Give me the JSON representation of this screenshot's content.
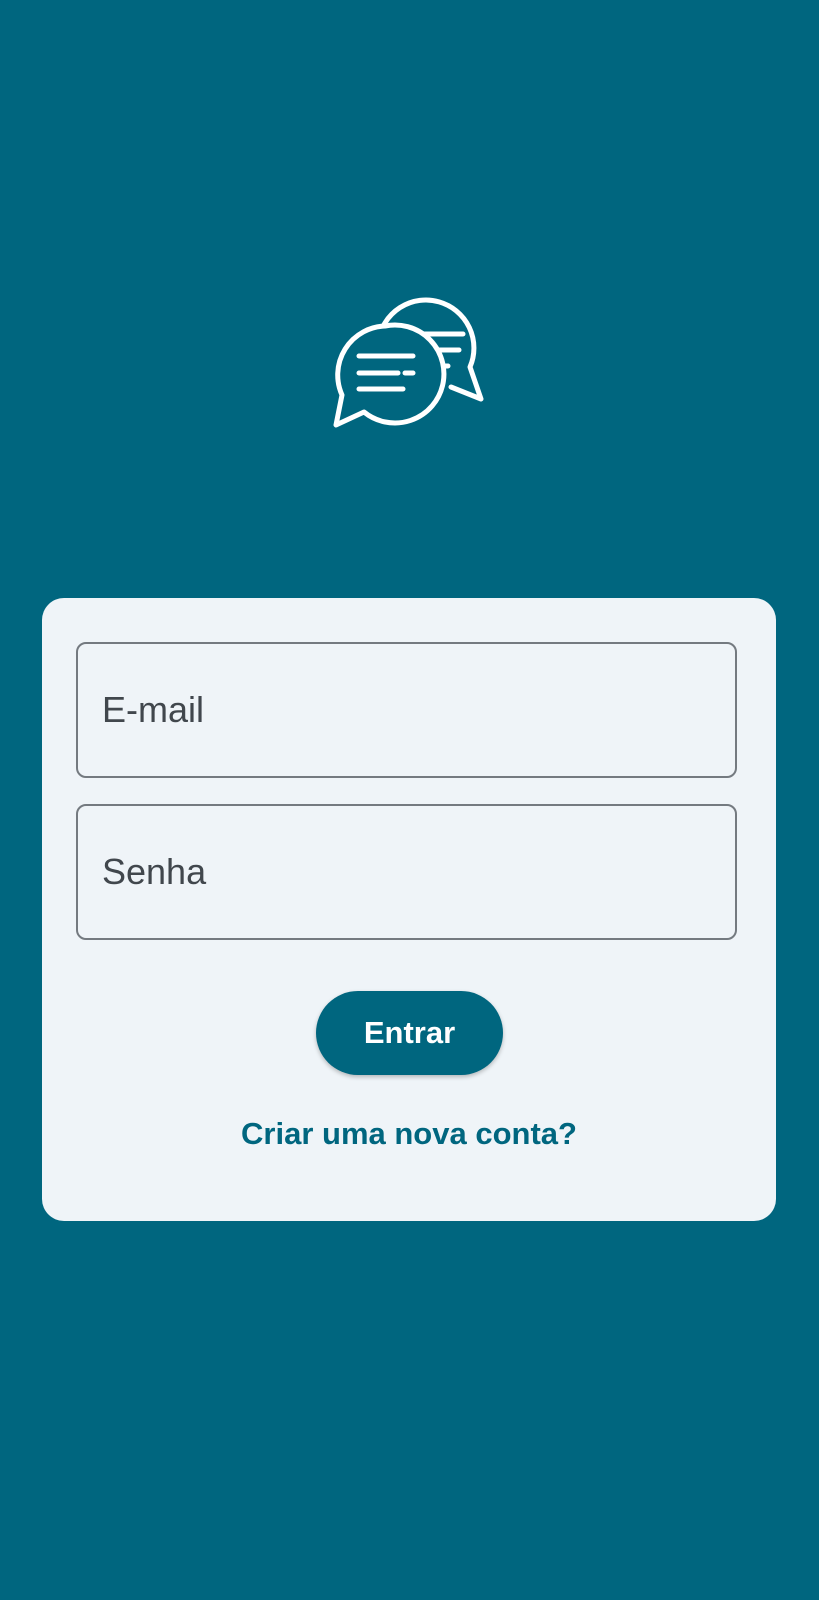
{
  "app": {
    "logo_icon": "chat-bubbles-icon"
  },
  "login_form": {
    "email_placeholder": "E-mail",
    "password_placeholder": "Senha",
    "submit_label": "Entrar",
    "signup_link_label": "Criar uma nova conta?"
  },
  "colors": {
    "background": "#00667f",
    "card": "#eff4f8",
    "primary": "#00667f",
    "field_border": "#747a80",
    "field_text": "#41474d"
  }
}
